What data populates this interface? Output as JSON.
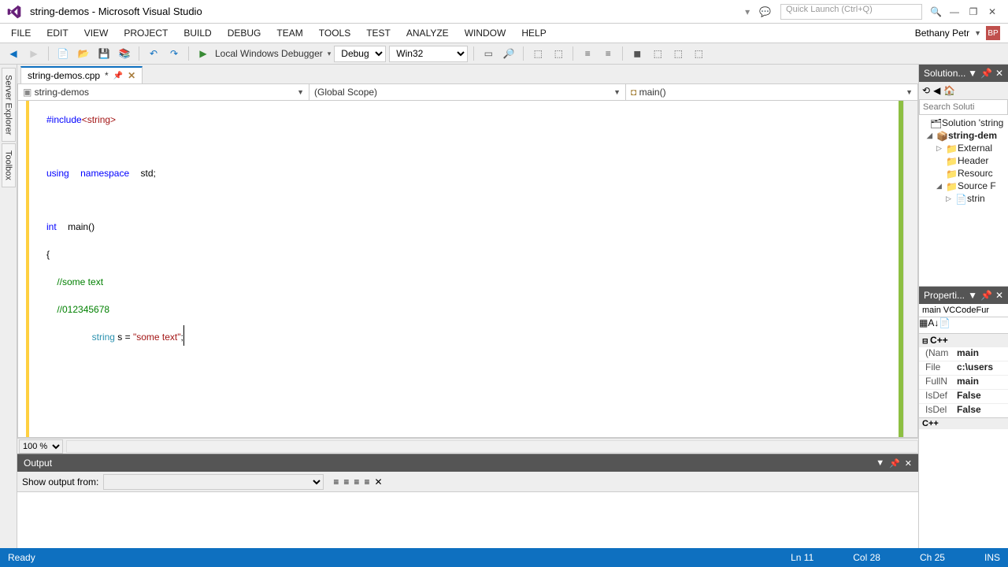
{
  "title": "string-demos - Microsoft Visual Studio",
  "quick_launch_placeholder": "Quick Launch (Ctrl+Q)",
  "user_name": "Bethany Petr",
  "user_initials": "BP",
  "menus": [
    "FILE",
    "EDIT",
    "VIEW",
    "PROJECT",
    "BUILD",
    "DEBUG",
    "TEAM",
    "TOOLS",
    "TEST",
    "ANALYZE",
    "WINDOW",
    "HELP"
  ],
  "toolbar": {
    "debugger_label": "Local Windows Debugger",
    "config": "Debug",
    "platform": "Win32"
  },
  "side_tabs": [
    "Server Explorer",
    "Toolbox"
  ],
  "editor_tab": "string-demos.cpp",
  "editor_tab_modified": "*",
  "nav": {
    "project": "string-demos",
    "scope": "(Global Scope)",
    "function": "main()"
  },
  "code": {
    "l1_kw": "#include",
    "l1_hdr": "<string>",
    "l3_kw1": "using",
    "l3_kw2": "namespace",
    "l3_id": "std;",
    "l5_kw": "int",
    "l5_fn": "main()",
    "l6": "{",
    "l7": "    //some text",
    "l8": "    //012345678",
    "l9_ty": "string",
    "l9_mid": " s = ",
    "l9_str": "\"some text\"",
    "l9_end": ";"
  },
  "zoom": "100 %",
  "output": {
    "title": "Output",
    "show_from_label": "Show output from:"
  },
  "solution_explorer": {
    "title": "Solution...",
    "search_placeholder": "Search Soluti",
    "root": "Solution 'string",
    "project": "string-dem",
    "items": [
      "External",
      "Header",
      "Resourc",
      "Source F",
      "strin"
    ]
  },
  "properties": {
    "title": "Properti...",
    "object": "main VCCodeFur",
    "cat": "C++",
    "rows": [
      {
        "k": "(Nam",
        "v": "main"
      },
      {
        "k": "File",
        "v": "c:\\users"
      },
      {
        "k": "FullN",
        "v": "main"
      },
      {
        "k": "IsDef",
        "v": "False"
      },
      {
        "k": "IsDel",
        "v": "False"
      }
    ],
    "cat2": "C++"
  },
  "status": {
    "ready": "Ready",
    "ln": "Ln 11",
    "col": "Col 28",
    "ch": "Ch 25",
    "ins": "INS"
  }
}
